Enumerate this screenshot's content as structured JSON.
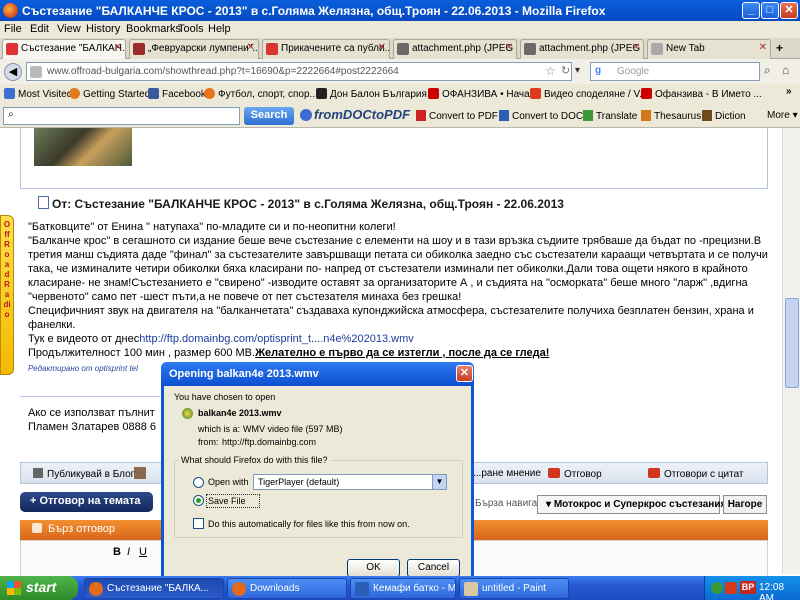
{
  "window": {
    "title": "Състезание \"БАЛКАНЧЕ КРОС - 2013\" в с.Голяма Желязна, общ.Троян - 22.06.2013 - Mozilla Firefox"
  },
  "menu": [
    "File",
    "Edit",
    "View",
    "History",
    "Bookmarks",
    "Tools",
    "Help"
  ],
  "tabs": [
    {
      "label": "Състезание \"БАЛКАН...",
      "icon_color": "#d33"
    },
    {
      "label": "„Февруарски лумпени\"...",
      "icon_color": "#9c2a2a"
    },
    {
      "label": "Прикачените са публи...",
      "icon_color": "#d33"
    },
    {
      "label": "attachment.php (JPEG ...",
      "icon_color": "#6a6a6a"
    },
    {
      "label": "attachment.php (JPEG ...",
      "icon_color": "#6a6a6a"
    },
    {
      "label": "New Tab",
      "icon_color": "#aaa"
    }
  ],
  "nav": {
    "url": "www.offroad-bulgaria.com/showthread.php?t=16690&p=2222664#post2222664",
    "search_placeholder": "Google"
  },
  "bookmarks": [
    {
      "label": "Most Visited",
      "color": "#3b6fd0"
    },
    {
      "label": "Getting Started",
      "color": "#e07a1e"
    },
    {
      "label": "Facebook",
      "color": "#3b5998"
    },
    {
      "label": "Футбол, спорт, спор...",
      "color": "#e8741a"
    },
    {
      "label": "Дон Балон България ...",
      "color": "#222"
    },
    {
      "label": "ОФАНЗИВА • Начало",
      "color": "#c00"
    },
    {
      "label": "Видео споделяне / V...",
      "color": "#e03a1a"
    },
    {
      "label": "Офанзива - В Името ...",
      "color": "#c00"
    }
  ],
  "toolbar2": {
    "search_value": "",
    "search_button": "Search",
    "brand": "fromDOCtoPDF",
    "items": [
      "Convert to PDF",
      "Convert to DOC",
      "Translate",
      "Thesaurus",
      "Diction",
      "More"
    ]
  },
  "post": {
    "title": "От: Състезание \"БАЛКАНЧЕ КРОС - 2013\" в с.Голяма Желязна, общ.Троян - 22.06.2013",
    "lines": [
      "\"Батковците\" от Енина \" натупаха\" по-младите си и по-неопитни колеги!",
      "\"Балканче крос\" в сегашното си издание беше вече състезание с елементи на шоу и в тази връзка съдиите трябваше да бъдат по -прецизни.В третия манш съдията даде \"финал\" за състезателите завършващи петата си обиколка заедно със състезатели караащи четвъртата и се получи така, че изминалите четири обиколки бяха класирани по- напред от състезатели изминали пет обиколки.Дали това ощети някого в крайното класиране- не знам!Състезанието е \"свирено\" -изводите оставят за организаторите А , и съдията на \"осморката\" беше много \"ларж\" ,вдигна \"червеното\" само пет -шест пъти,а не повече от пет състезателя минаха без грешка!",
      "Специфичният звук на двигателя на \"балканчетата\" създаваха купонджийска атмосфера, състезателите получиха безплатен бензин, храна и фанелки."
    ],
    "video_prefix": "Тук е видеото от днес",
    "video_link": "http://ftp.domainbg.com/optisprint_t....n4e%202013.wmv",
    "duration_text": "Продължителност 100 мин , размер 600 МВ.",
    "wish_text": "Желателно е първо да се изтегли , после да се гледа!",
    "edited": "Редактирано от optisprint tel",
    "signature": [
      "Ако се използват пълнит",
      "Пламен Златарев 0888 6"
    ]
  },
  "sidebar_badge": "OffRoad Radio",
  "post_actions": {
    "blog": "Публикувай в Блог",
    "bad_post": "...ране мнение",
    "reply": "Отговор",
    "quote": "Отговори с цитат"
  },
  "thread": {
    "reply_button": "+ Отговор на темата",
    "nav_label": "Бърза навигация",
    "forum_select": "Мотокрос и Суперкрос състезания",
    "go_button": "Нагоре",
    "quick_reply": "Бърз отговор"
  },
  "dialog": {
    "title": "Opening balkan4e 2013.wmv",
    "chosen_text": "You have chosen to open",
    "filename": "balkan4e 2013.wmv",
    "which_is_label": "which is a:",
    "which_is_value": "WMV video file (597 MB)",
    "from_label": "from:",
    "from_value": "http://ftp.domainbg.com",
    "question": "What should Firefox do with this file?",
    "open_with_label": "Open with",
    "open_with_app": "TigerPlayer (default)",
    "save_label": "Save File",
    "auto_label": "Do this automatically for files like this from now on.",
    "ok": "OK",
    "cancel": "Cancel",
    "selected": "save"
  },
  "taskbar": {
    "start": "start",
    "tasks": [
      {
        "label": "Състезание \"БАЛКА...",
        "color": "#e36b1c",
        "active": true
      },
      {
        "label": "Downloads",
        "color": "#e36b1c",
        "active": false
      },
      {
        "label": "Кемафи батко - Micr...",
        "color": "#2b5fb5",
        "active": false
      },
      {
        "label": "untitled - Paint",
        "color": "#d9c7a1",
        "active": false
      }
    ],
    "lang": "BP",
    "clock": "12:08 AM"
  }
}
